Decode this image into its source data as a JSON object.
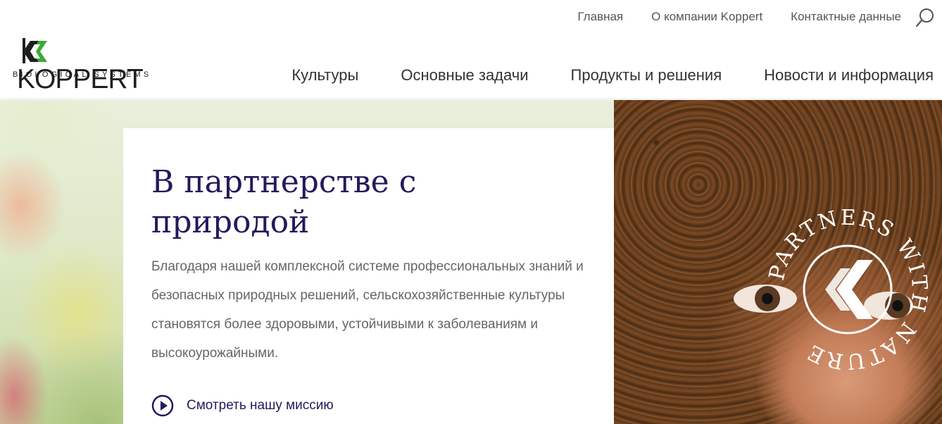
{
  "brand": {
    "name": "KOPPERT",
    "tagline": "BIOLOGICAL SYSTEMS",
    "accent_color": "#3aaa35"
  },
  "top_nav": [
    {
      "label": "Главная"
    },
    {
      "label": "О компании Koppert"
    },
    {
      "label": "Контактные данные"
    }
  ],
  "main_nav": [
    {
      "label": "Культуры"
    },
    {
      "label": "Основные задачи"
    },
    {
      "label": "Продукты и решения"
    },
    {
      "label": "Новости и информация"
    }
  ],
  "hero": {
    "title": "В партнерстве с природой",
    "description": "Благодаря нашей комплексной системе профессиональных знаний и безопасных природных решений, сельскохозяйственные культуры становятся более здоровыми, устойчивыми к заболеваниям и высокоурожайными.",
    "mission_link": "Смотреть нашу миссию",
    "badge_text": "PARTNERS WITH NATURE",
    "title_color": "#221a5c"
  },
  "icons": {
    "search": "search-icon",
    "play": "play-circle-icon"
  }
}
